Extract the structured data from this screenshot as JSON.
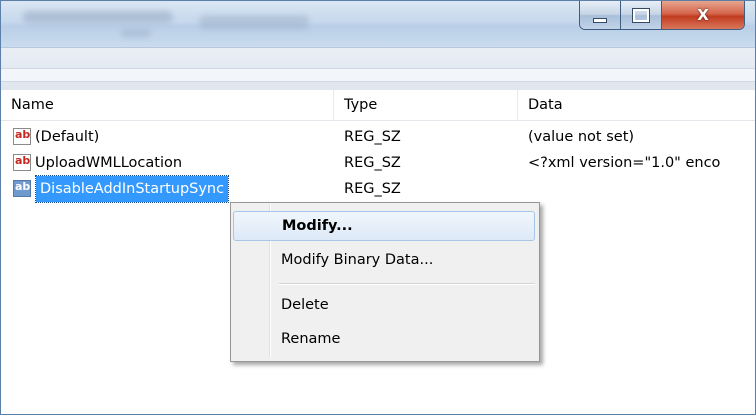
{
  "window": {
    "close_glyph": "X"
  },
  "columns": {
    "name": "Name",
    "type": "Type",
    "data": "Data"
  },
  "rows": [
    {
      "name": "(Default)",
      "type": "REG_SZ",
      "data": "(value not set)",
      "icon": "string-value-icon"
    },
    {
      "name": "UploadWMLLocation",
      "type": "REG_SZ",
      "data": "<?xml version=\"1.0\" enco",
      "icon": "string-value-icon"
    },
    {
      "name": "DisableAddInStartupSync",
      "type": "REG_SZ",
      "data": "",
      "icon": "string-value-icon",
      "selected": true
    }
  ],
  "icon_text": "ab",
  "context_menu": {
    "items": [
      "Modify...",
      "Modify Binary Data...",
      "Delete",
      "Rename"
    ],
    "highlighted": "Modify..."
  },
  "colors": {
    "selection": "#3399ff",
    "icon_red": "#c4271e",
    "close_button": "#c23b1f"
  }
}
